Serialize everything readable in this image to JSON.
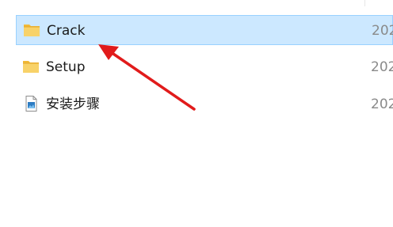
{
  "files": [
    {
      "name": "Crack",
      "date": "202",
      "icon": "folder-icon",
      "selected": true
    },
    {
      "name": "Setup",
      "date": "202",
      "icon": "folder-icon",
      "selected": false
    },
    {
      "name": "安装步骤",
      "date": "202",
      "icon": "image-file-icon",
      "selected": false
    }
  ],
  "colors": {
    "selection_bg": "#cce8ff",
    "selection_border": "#99d1ff",
    "folder": "#f8c74a",
    "arrow": "#e11b1b"
  },
  "annotation": {
    "icon": "red-arrow-pointer"
  }
}
